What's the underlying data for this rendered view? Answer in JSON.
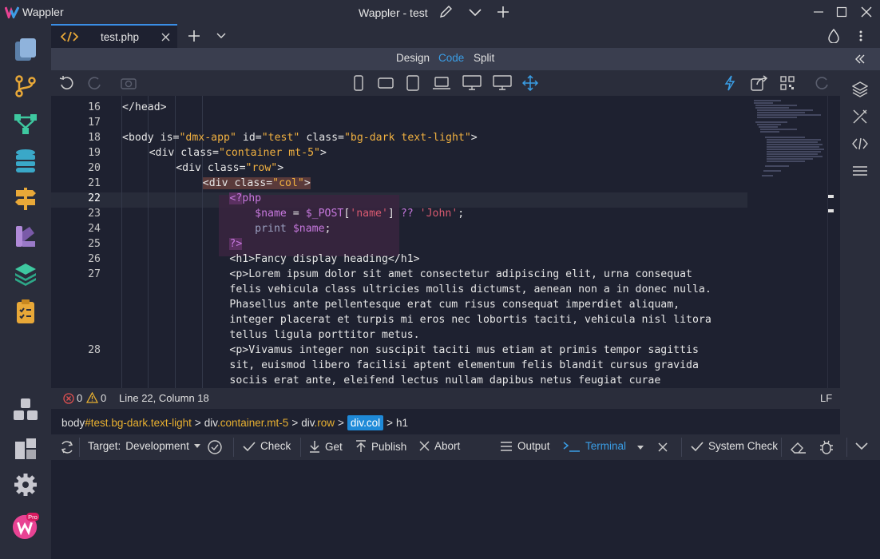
{
  "window": {
    "app_name": "Wappler",
    "title": "Wappler - test"
  },
  "tab": {
    "name": "test.php"
  },
  "views": {
    "design": "Design",
    "code": "Code",
    "split": "Split",
    "active": "Code"
  },
  "editor": {
    "lines": [
      {
        "num": "16",
        "html": "&lt;/head&gt;",
        "indent": 0
      },
      {
        "num": "17",
        "html": "",
        "indent": 0
      },
      {
        "num": "18",
        "html": "<span class='t'>&lt;body</span> <span class='a'>is=</span><span class='s'>\"dmx-app\"</span> <span class='a'>id=</span><span class='s'>\"test\"</span> <span class='a'>class=</span><span class='s'>\"bg-dark text-light\"</span><span class='t'>&gt;</span>",
        "indent": 0
      },
      {
        "num": "19",
        "html": "&lt;div class=<span class='s'>\"container mt-5\"</span>&gt;",
        "indent": 1
      },
      {
        "num": "20",
        "html": "&lt;div class=<span class='s'>\"row\"</span>&gt;",
        "indent": 2
      },
      {
        "num": "21",
        "html": "<span style='background:#5a3a3a'>&lt;div class=<span class='s'>\"col\"</span>&gt;</span>",
        "indent": 3
      },
      {
        "num": "22",
        "html": "<span class='pg' style='background:#5a3060'>&lt;?</span><span class='pg'>php</span>",
        "indent": 4
      },
      {
        "num": "23",
        "html": "    <span class='pv'>$name</span> = <span class='pv'>$_POST</span>[<span class='ps'>'name'</span>] <span class='pv'>??</span> <span class='ps'>'John'</span>;",
        "indent": 4
      },
      {
        "num": "24",
        "html": "    <span class='k'>print</span> <span class='pv'>$name</span>;",
        "indent": 4
      },
      {
        "num": "25",
        "html": "<span class='pg' style='background:#5a3060'>?&gt;</span>",
        "indent": 4
      },
      {
        "num": "26",
        "html": "&lt;h1&gt;Fancy display heading&lt;/h1&gt;",
        "indent": 4
      },
      {
        "num": "27",
        "html": "&lt;p&gt;Lorem ipsum dolor sit amet consectetur adipiscing elit, urna consequat",
        "indent": 4
      },
      {
        "num": "",
        "html": "felis vehicula class ultricies mollis dictumst, aenean non a in donec nulla.",
        "indent": 4
      },
      {
        "num": "",
        "html": "Phasellus ante pellentesque erat cum risus consequat imperdiet aliquam,",
        "indent": 4
      },
      {
        "num": "",
        "html": "integer placerat et turpis mi eros nec lobortis taciti, vehicula nisl litora",
        "indent": 4
      },
      {
        "num": "",
        "html": "tellus ligula porttitor metus.",
        "indent": 4
      },
      {
        "num": "28",
        "html": "&lt;p&gt;Vivamus integer non suscipit taciti mus etiam at primis tempor sagittis",
        "indent": 4
      },
      {
        "num": "",
        "html": "sit, euismod libero facilisi aptent elementum felis blandit cursus gravida",
        "indent": 4
      },
      {
        "num": "",
        "html": "sociis erat ante, eleifend lectus nullam dapibus netus feugiat curae",
        "indent": 4
      }
    ]
  },
  "status": {
    "errors": "0",
    "warnings": "0",
    "position": "Line 22, Column 18",
    "eol": "LF"
  },
  "breadcrumb": {
    "b1_tag": "body",
    "b1_id": "#test",
    "b1_cls": ".bg-dark.text-light",
    "b2_tag": "div",
    "b2_cls": ".container.mt-5",
    "b3_tag": "div",
    "b3_cls": ".row",
    "b4": "div.col",
    "b5": "h1",
    "sep": ">"
  },
  "bottombar": {
    "target_label": "Target:",
    "target_value": "Development",
    "check": "Check",
    "get": "Get",
    "publish": "Publish",
    "abort": "Abort",
    "output": "Output",
    "terminal": "Terminal",
    "system_check": "System Check"
  },
  "colors": {
    "accent": "#3a9ee6",
    "selected_crumb": "#1f8ad8"
  }
}
